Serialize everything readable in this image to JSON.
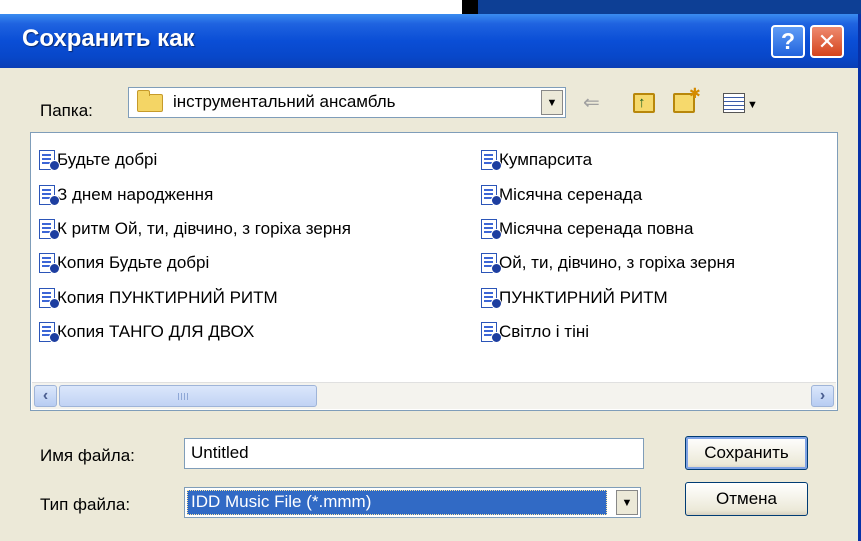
{
  "dialog": {
    "title": "Сохранить как",
    "help_glyph": "?",
    "close_glyph": "✕"
  },
  "folder": {
    "label": "Папка:",
    "value": "інструментальний ансамбль"
  },
  "toolbar": {
    "icons": [
      "back-arrow-icon",
      "up-folder-icon",
      "new-folder-icon",
      "view-menu-icon"
    ]
  },
  "files": {
    "column1": [
      "Будьте добрі",
      "З днем народження",
      "К ритм Ой, ти, дівчино, з горіха зерня",
      "Копия Будьте добрі",
      "Копия ПУНКТИРНИЙ РИТМ",
      "Копия ТАНГО ДЛЯ ДВОХ"
    ],
    "column2": [
      "Кумпарсита",
      "Місячна серенада",
      "Місячна серенада повна",
      "Ой, ти, дівчино, з горіха зерня",
      "ПУНКТИРНИЙ РИТМ",
      "Світло і тіні"
    ]
  },
  "filename": {
    "label": "Имя файла:",
    "value": "Untitled"
  },
  "filetype": {
    "label": "Тип файла:",
    "value": "IDD Music File (*.mmm)"
  },
  "buttons": {
    "save": "Сохранить",
    "cancel": "Отмена"
  },
  "colors": {
    "titlebar": "#0a4ed6",
    "dialog_bg": "#ece9d8",
    "selection": "#316ac5"
  }
}
